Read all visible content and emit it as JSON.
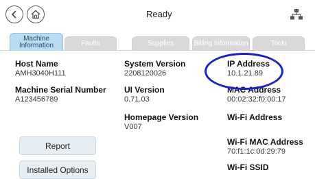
{
  "header": {
    "status": "Ready",
    "back_icon": "back-arrow-icon",
    "home_icon": "home-icon",
    "network_icon": "network-icon"
  },
  "tabs": [
    {
      "label": "Machine Information",
      "active": true
    },
    {
      "label": "Faults",
      "active": false
    },
    {
      "label": "Supplies",
      "active": false
    },
    {
      "label": "Billing Information",
      "active": false
    },
    {
      "label": "Tools",
      "active": false
    }
  ],
  "info": {
    "host_name": {
      "label": "Host Name",
      "value": "AMH3040H111"
    },
    "serial_number": {
      "label": "Machine Serial Number",
      "value": "A123456789"
    },
    "system_version": {
      "label": "System Version",
      "value": "2208120026"
    },
    "ui_version": {
      "label": "UI Version",
      "value": "0.71.03"
    },
    "homepage_version": {
      "label": "Homepage Version",
      "value": "V007"
    },
    "ip_address": {
      "label": "IP Address",
      "value": "10.1.21.89"
    },
    "mac_address": {
      "label": "MAC Address",
      "value": "00:02:32:f0:00:17"
    },
    "wifi_address": {
      "label": "Wi-Fi Address",
      "value": ""
    },
    "wifi_mac_address": {
      "label": "Wi-Fi MAC Address",
      "value": "70:f1:1c:0d:29:79"
    },
    "wifi_ssid": {
      "label": "Wi-Fi SSID",
      "value": ""
    }
  },
  "buttons": {
    "report": "Report",
    "installed_options": "Installed Options"
  },
  "colors": {
    "active_tab": "#b9dcf2",
    "inactive_tab": "#d9d9d9",
    "highlight": "#1a21d1",
    "button_bg": "#e6edf3"
  }
}
